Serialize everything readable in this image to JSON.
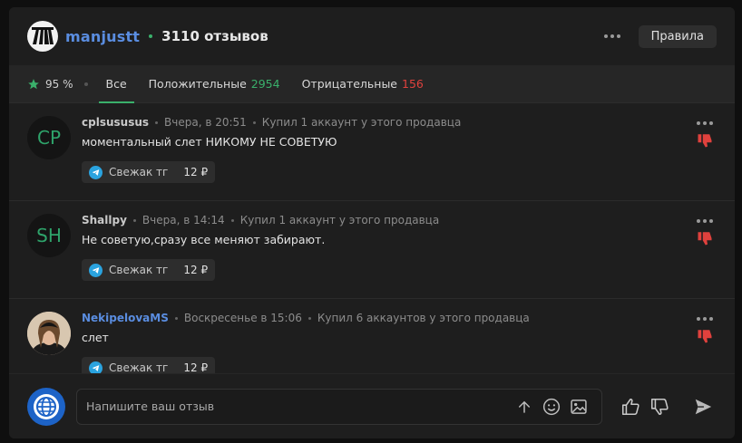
{
  "header": {
    "seller_name": "manjustt",
    "review_count": "3110 отзывов",
    "rules_label": "Правила"
  },
  "filters": {
    "rating": "95 %",
    "tab_all": "Все",
    "tab_positive": "Положительные",
    "positive_count": "2954",
    "tab_negative": "Отрицательные",
    "negative_count": "156"
  },
  "reviews": [
    {
      "initials": "CP",
      "author": "cplsususus",
      "time": "Вчера, в 20:51",
      "purchase": "Купил 1 аккаунт у этого продавца",
      "text": "моментальный слет НИКОМУ НЕ СОВЕТУЮ",
      "product": "Свежак тг",
      "price": "12 ₽"
    },
    {
      "initials": "SH",
      "author": "Shallpy",
      "time": "Вчера, в 14:14",
      "purchase": "Купил 1 аккаунт у этого продавца",
      "text": "Не советую,сразу все меняют забирают.",
      "product": "Свежак тг",
      "price": "12 ₽"
    },
    {
      "initials": "",
      "author": "NekipelovaMS",
      "time": "Воскресенье в 15:06",
      "purchase": "Купил 6 аккаунтов у этого продавца",
      "text": "слет",
      "product": "Свежак тг",
      "price": "12 ₽"
    }
  ],
  "composer": {
    "placeholder": "Напишите ваш отзыв"
  },
  "colors": {
    "accent_green": "#3ab06b",
    "negative_red": "#e0413d",
    "link_blue": "#5a8de0"
  }
}
